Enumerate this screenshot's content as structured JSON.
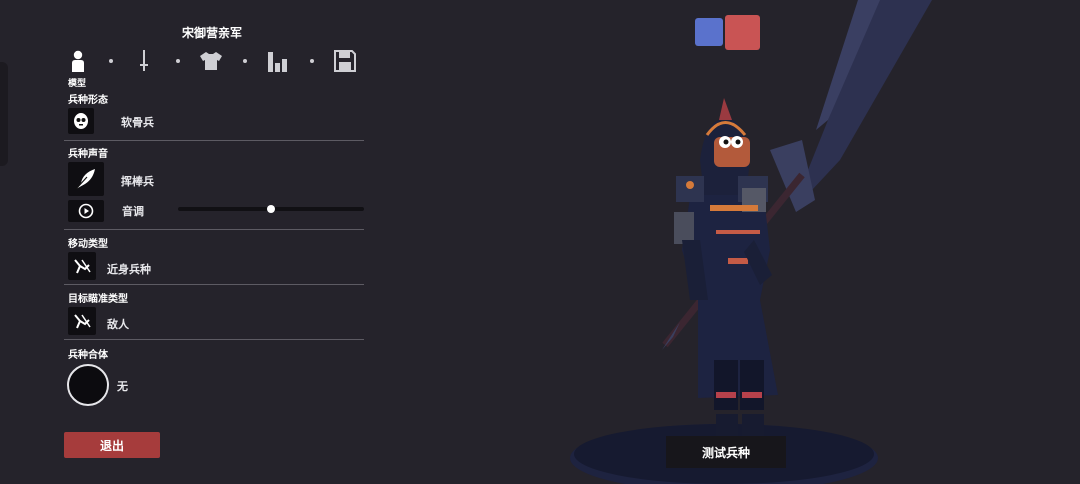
{
  "unit_title": "宋御营亲军",
  "toolbar": {
    "tools": [
      {
        "icon": "person-icon",
        "label": "模型",
        "active": true
      },
      {
        "icon": "sword-icon"
      },
      {
        "icon": "shirt-icon"
      },
      {
        "icon": "stats-icon"
      },
      {
        "icon": "save-icon"
      }
    ]
  },
  "sections": {
    "form": {
      "title": "兵种形态",
      "icon": "skull-face-icon",
      "value": "软骨兵"
    },
    "voice": {
      "title": "兵种声音",
      "icon": "feather-icon",
      "value": "挥棒兵",
      "pitch_label": "音调",
      "pitch_value": 0.5,
      "play_icon": "play-icon"
    },
    "movement": {
      "title": "移动类型",
      "icon": "melee-icon",
      "value": "近身兵种"
    },
    "targeting": {
      "title": "目标瞄准类型",
      "icon": "target-enemy-icon",
      "value": "敌人"
    },
    "combine": {
      "title": "兵种合体",
      "value": "无"
    }
  },
  "exit_label": "退出",
  "test_label": "测试兵种",
  "team_colors": {
    "blue": "#5a72cc",
    "red": "#c95454"
  },
  "colors": {
    "background": "#25232b",
    "exit_button": "#a63c3c",
    "divider": "#5d5b63"
  }
}
